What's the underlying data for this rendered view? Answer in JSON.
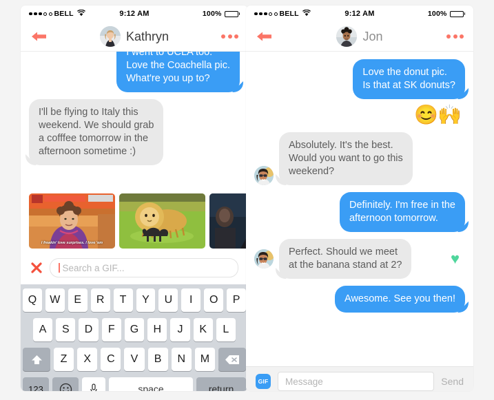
{
  "colors": {
    "page_background": "#f4f4f4",
    "bubble_outgoing": "#3a9df5",
    "bubble_incoming": "#e9e9e9",
    "accent_coral": "#fb7567",
    "heart_green": "#4fd69c",
    "keyboard_background": "#d3d7dc"
  },
  "left_phone": {
    "status_bar": {
      "carrier": "BELL",
      "signal_filled": 3,
      "signal_empty": 2,
      "wifi_icon": "wifi-icon",
      "time": "9:12 AM",
      "battery_percent": "100%",
      "battery_icon": "battery-full-icon"
    },
    "nav": {
      "back_icon": "back-arrow-icon",
      "avatar": "avatar-kathryn",
      "name": "Kathryn",
      "more_icon": "more-options-icon"
    },
    "messages": [
      {
        "direction": "out",
        "text": "I went to UCLA too.\nLove the Coachella pic.\nWhat're you up to?",
        "clipped_top": true
      },
      {
        "direction": "in",
        "text": "I'll be flying to Italy this\nweekend. We should grab\na cofffee tomorrow in the\nafternoon sometime :)"
      }
    ],
    "gif_strip": {
      "thumbnails": [
        {
          "name": "gif-thumb-surprises",
          "caption": "I freakin' love surprises.\nI love 'em"
        },
        {
          "name": "gif-thumb-lion-guinea-pig",
          "caption": ""
        },
        {
          "name": "gif-thumb-aziz",
          "caption": ""
        }
      ]
    },
    "gif_search": {
      "close_icon": "close-x-icon",
      "placeholder": "Search a GIF...",
      "value": ""
    },
    "keyboard": {
      "row1": [
        "Q",
        "W",
        "E",
        "R",
        "T",
        "Y",
        "U",
        "I",
        "O",
        "P"
      ],
      "row2": [
        "A",
        "S",
        "D",
        "F",
        "G",
        "H",
        "J",
        "K",
        "L"
      ],
      "row3": [
        "Z",
        "X",
        "C",
        "V",
        "B",
        "N",
        "M"
      ],
      "shift_icon": "shift-arrow-icon",
      "backspace_icon": "backspace-icon",
      "numbers_key": "123",
      "emoji_icon": "emoji-smiley-icon",
      "mic_icon": "microphone-icon",
      "space_key": "space",
      "return_key": "return"
    }
  },
  "right_phone": {
    "status_bar": {
      "carrier": "BELL",
      "signal_filled": 3,
      "signal_empty": 2,
      "wifi_icon": "wifi-icon",
      "time": "9:12 AM",
      "battery_percent": "100%",
      "battery_icon": "battery-full-icon"
    },
    "nav": {
      "back_icon": "back-arrow-icon",
      "avatar": "avatar-jon",
      "name": "Jon",
      "more_icon": "more-options-icon"
    },
    "messages": [
      {
        "direction": "out",
        "text": "Love the donut pic.\nIs that at SK donuts?"
      },
      {
        "direction": "emoji",
        "text": "😊🙌"
      },
      {
        "direction": "in",
        "avatar": true,
        "text": "Absolutely. It's the best.\nWould you want to go this\nweekend?"
      },
      {
        "direction": "out",
        "text": "Definitely. I'm free in the\nafternoon tomorrow."
      },
      {
        "direction": "in",
        "avatar": true,
        "heart": "♥",
        "text": "Perfect. Should we meet\nat the banana stand at 2?"
      },
      {
        "direction": "out",
        "text": "Awesome. See you then!"
      }
    ],
    "input_bar": {
      "gif_button": "GIF",
      "placeholder": "Message",
      "value": "",
      "send_label": "Send"
    }
  }
}
